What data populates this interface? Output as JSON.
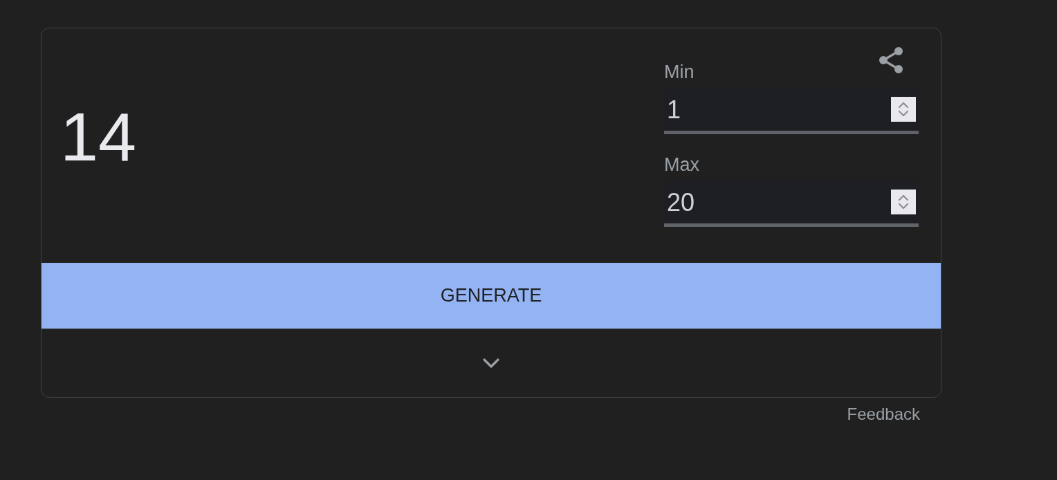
{
  "result": {
    "value": "14"
  },
  "fields": [
    {
      "label": "Min",
      "value": "1"
    },
    {
      "label": "Max",
      "value": "20"
    }
  ],
  "generate_button": {
    "label": "GENERATE"
  },
  "expander": {
    "expanded": false
  },
  "feedback_link": {
    "label": "Feedback"
  }
}
